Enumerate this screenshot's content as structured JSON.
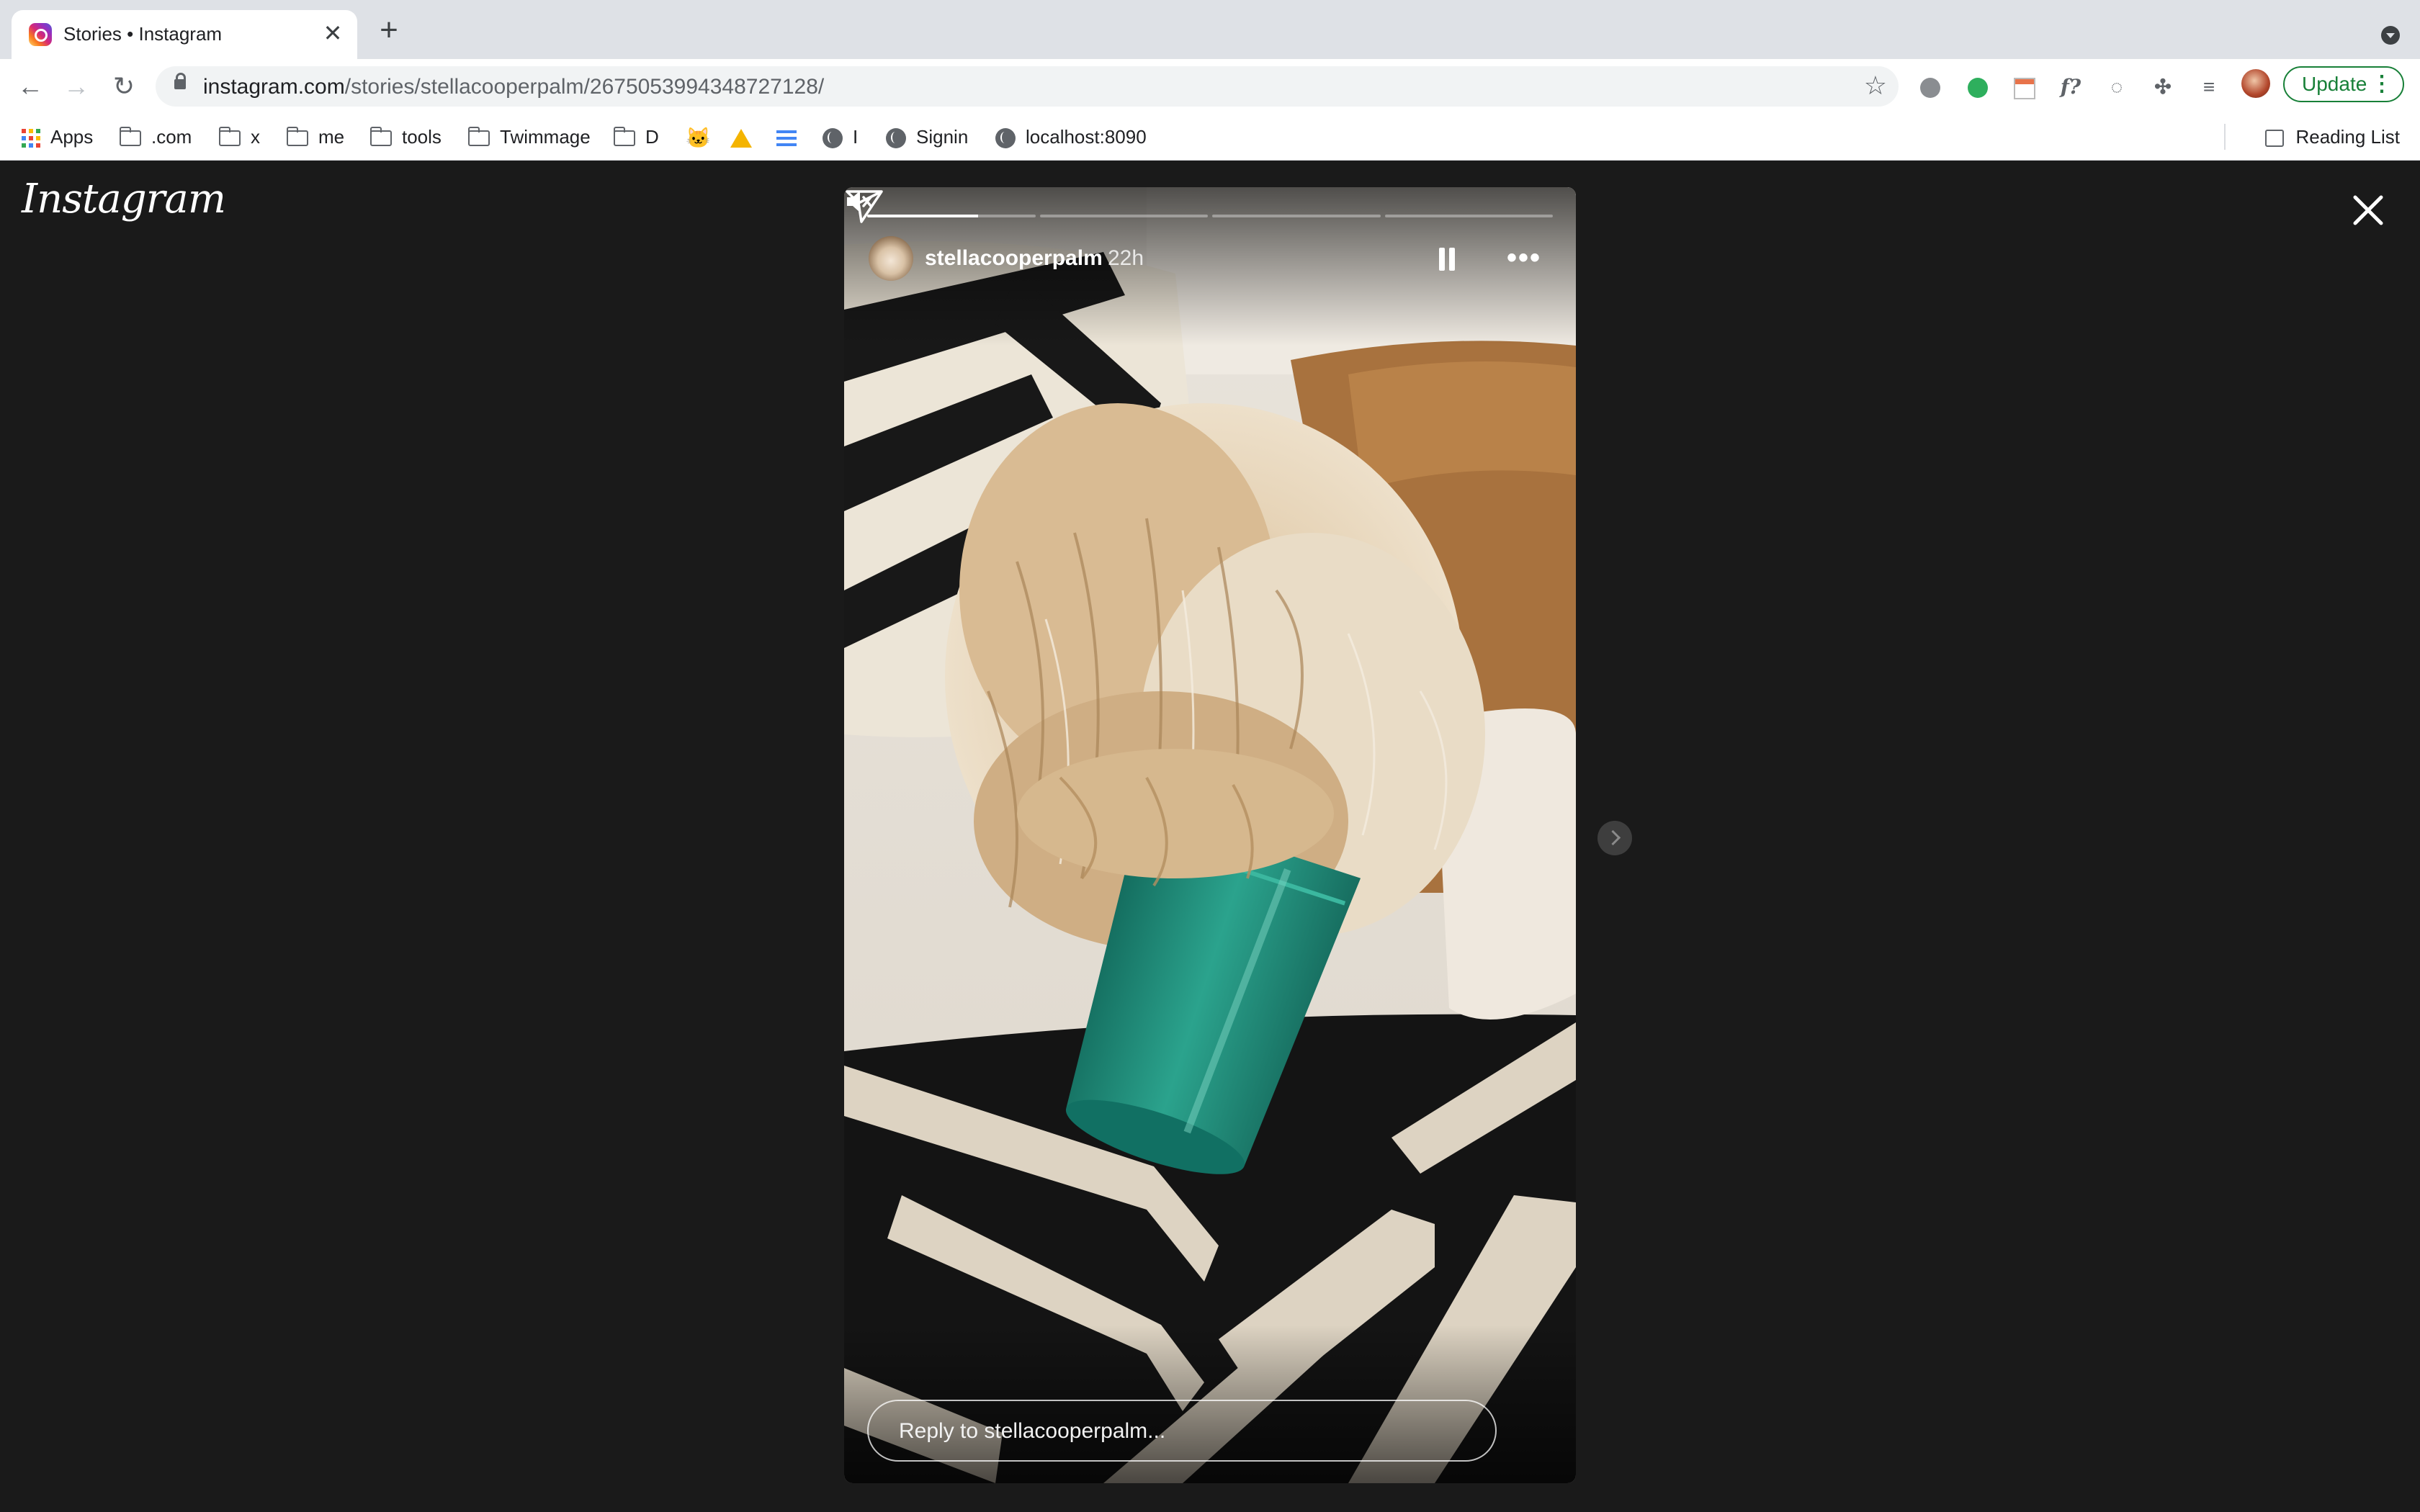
{
  "browser": {
    "tab_title": "Stories • Instagram",
    "tab_close": "✕",
    "new_tab": "+",
    "url_host": "instagram.com",
    "url_path": "/stories/stellacooperpalm/2675053994348727128/",
    "update_label": "Update",
    "bookmarks": [
      {
        "label": "Apps",
        "icon": "apps-grid-icon"
      },
      {
        "label": ".com",
        "icon": "folder-icon"
      },
      {
        "label": "x",
        "icon": "folder-icon"
      },
      {
        "label": "me",
        "icon": "folder-icon"
      },
      {
        "label": "tools",
        "icon": "folder-icon"
      },
      {
        "label": "Twimmage",
        "icon": "folder-icon"
      },
      {
        "label": "D",
        "icon": "folder-icon"
      },
      {
        "label": "",
        "icon": "cat-icon"
      },
      {
        "label": "",
        "icon": "google-drive-icon"
      },
      {
        "label": "",
        "icon": "flow-icon"
      },
      {
        "label": "I",
        "icon": "globe-icon"
      },
      {
        "label": "Signin",
        "icon": "globe-icon"
      },
      {
        "label": "localhost:8090",
        "icon": "globe-icon"
      }
    ],
    "reading_list": "Reading List"
  },
  "instagram": {
    "logo": "Instagram",
    "story": {
      "username": "stellacooperpalm",
      "time_ago": "22h",
      "segments": 4,
      "current_segment_progress": 0.66,
      "reply_placeholder": "Reply to stellacooperpalm..."
    }
  },
  "colors": {
    "viewer_bg": "#1a1a1a",
    "update_green": "#188038",
    "cup_teal": "#1f8f7c"
  }
}
